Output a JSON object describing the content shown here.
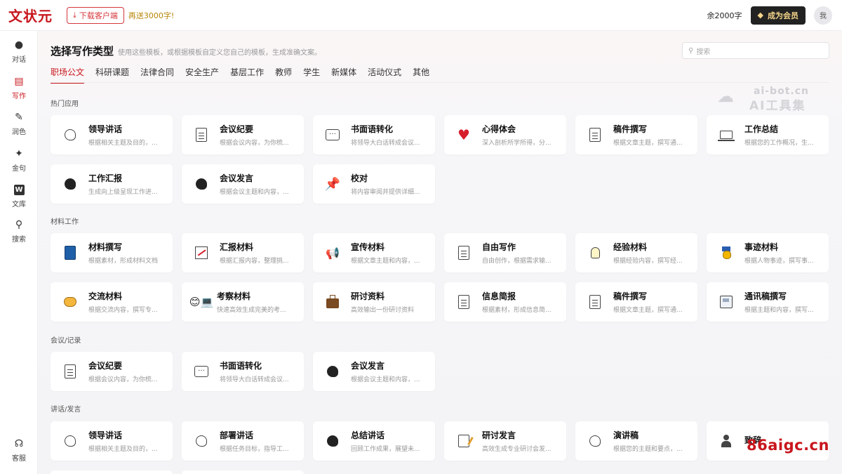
{
  "header": {
    "logo": "文状元",
    "download_label": "下载客户端",
    "gift_text": "再送3000字!",
    "quota": "余2000字",
    "vip_label": "成为会员",
    "avatar_text": "我"
  },
  "sidebar": {
    "items": [
      {
        "label": "对话",
        "icon": "chat-bubble-icon"
      },
      {
        "label": "写作",
        "icon": "document-icon"
      },
      {
        "label": "润色",
        "icon": "magic-wand-icon"
      },
      {
        "label": "金句",
        "icon": "sparkle-icon"
      },
      {
        "label": "文库",
        "icon": "w-library-icon"
      },
      {
        "label": "搜索",
        "icon": "search-icon"
      }
    ],
    "service_label": "客服"
  },
  "main": {
    "title": "选择写作类型",
    "subtitle": "使用这些模板，或根据模板自定义您自己的模板，生成准确文案。",
    "search_placeholder": "搜索",
    "tabs": [
      "职场公文",
      "科研课题",
      "法律合同",
      "安全生产",
      "基层工作",
      "教师",
      "学生",
      "新媒体",
      "活动仪式",
      "其他"
    ],
    "watermark_top": "ai-bot.cn",
    "watermark_top2": "AI工具集",
    "watermark_bottom": "86aigc.cn"
  },
  "sections": [
    {
      "title": "热门应用",
      "cards": [
        {
          "title": "领导讲话",
          "desc": "根据相关主题及目的，...",
          "icon": "head-profile-icon"
        },
        {
          "title": "会议纪要",
          "desc": "根据会议内容，为你梳...",
          "icon": "document-icon"
        },
        {
          "title": "书面语转化",
          "desc": "将领导大白话转成会议...",
          "icon": "speech-bubble-icon"
        },
        {
          "title": "心得体会",
          "desc": "深入剖析所学所得，分...",
          "icon": "heart-icon"
        },
        {
          "title": "稿件撰写",
          "desc": "根据文章主题，撰写通...",
          "icon": "document-icon"
        },
        {
          "title": "工作总结",
          "desc": "根据您的工作概况，生...",
          "icon": "laptop-icon"
        },
        {
          "title": "工作汇报",
          "desc": "生成向上级呈现工作进...",
          "icon": "speaking-head-icon"
        },
        {
          "title": "会议发言",
          "desc": "根据会议主题和内容，...",
          "icon": "speaking-head-icon"
        },
        {
          "title": "校对",
          "desc": "将内容审阅并提供详细...",
          "icon": "pushpin-icon"
        }
      ]
    },
    {
      "title": "材料工作",
      "cards": [
        {
          "title": "材料撰写",
          "desc": "根据素材，形成材料文档",
          "icon": "book-icon"
        },
        {
          "title": "汇报材料",
          "desc": "根据汇报内容，整理挑...",
          "icon": "chart-icon"
        },
        {
          "title": "宣传材料",
          "desc": "根据文章主题和内容，...",
          "icon": "megaphone-icon"
        },
        {
          "title": "自由写作",
          "desc": "自由创作，根据需求输...",
          "icon": "document-icon"
        },
        {
          "title": "经验材料",
          "desc": "根据经验内容，撰写经...",
          "icon": "lightbulb-icon"
        },
        {
          "title": "事迹材料",
          "desc": "根据人物事迹，撰写事...",
          "icon": "medal-icon"
        },
        {
          "title": "交流材料",
          "desc": "根据交流内容，撰写专...",
          "icon": "handshake-icon"
        },
        {
          "title": "考察材料",
          "desc": "快速高效生成完美的考...",
          "icon": "face-laptop-icon"
        },
        {
          "title": "研讨资料",
          "desc": "高效输出一份研讨资料",
          "icon": "briefcase-icon"
        },
        {
          "title": "信息简报",
          "desc": "根据素材，形成信息简...",
          "icon": "document-icon"
        },
        {
          "title": "稿件撰写",
          "desc": "根据文章主题，撰写通...",
          "icon": "document-icon"
        },
        {
          "title": "通讯稿撰写",
          "desc": "根据主题和内容，撰写...",
          "icon": "newspaper-icon"
        }
      ]
    },
    {
      "title": "会议/记录",
      "cards": [
        {
          "title": "会议纪要",
          "desc": "根据会议内容，为你梳...",
          "icon": "document-icon"
        },
        {
          "title": "书面语转化",
          "desc": "将领导大白话转成会议...",
          "icon": "speech-bubble-icon"
        },
        {
          "title": "会议发言",
          "desc": "根据会议主题和内容，...",
          "icon": "speaking-head-icon"
        }
      ]
    },
    {
      "title": "讲话/发言",
      "cards": [
        {
          "title": "领导讲话",
          "desc": "根据相关主题及目的，...",
          "icon": "head-profile-icon"
        },
        {
          "title": "部署讲话",
          "desc": "根据任务目标，指导工...",
          "icon": "head-profile-icon"
        },
        {
          "title": "总结讲话",
          "desc": "回顾工作成果，展望未...",
          "icon": "speaking-head-icon"
        },
        {
          "title": "研讨发言",
          "desc": "高效生成专业研讨会发...",
          "icon": "pen-paper-icon"
        },
        {
          "title": "演讲稿",
          "desc": "根据您的主题和要点，...",
          "icon": "head-profile-icon"
        },
        {
          "title": "致辞",
          "desc": "",
          "icon": "person-icon"
        }
      ]
    }
  ]
}
